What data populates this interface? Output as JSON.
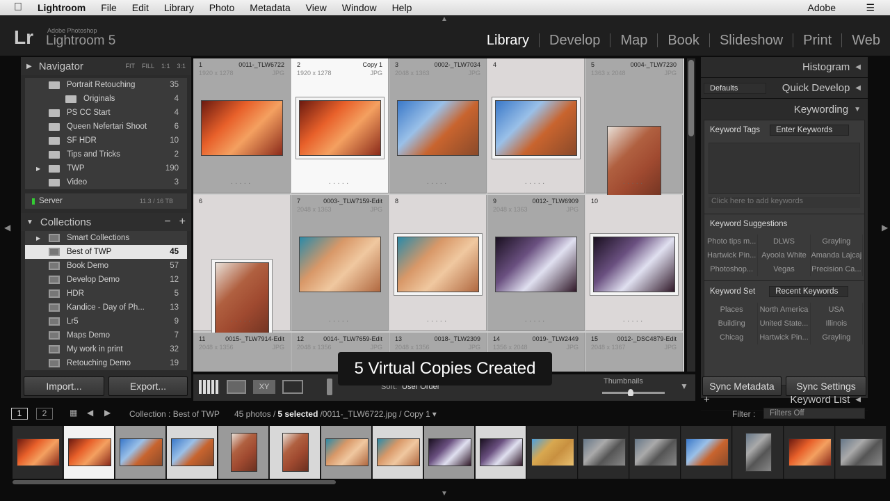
{
  "menubar": {
    "app": "Lightroom",
    "items": [
      "File",
      "Edit",
      "Library",
      "Photo",
      "Metadata",
      "View",
      "Window",
      "Help"
    ],
    "right": "Adobe"
  },
  "brand": {
    "logo": "Lr",
    "sub": "Adobe Photoshop",
    "name": "Lightroom 5"
  },
  "modules": [
    {
      "label": "Library",
      "active": true
    },
    {
      "label": "Develop"
    },
    {
      "label": "Map"
    },
    {
      "label": "Book"
    },
    {
      "label": "Slideshow"
    },
    {
      "label": "Print"
    },
    {
      "label": "Web"
    }
  ],
  "navigator": {
    "title": "Navigator",
    "zoom": [
      "FIT",
      "FILL",
      "1:1",
      "3:1"
    ]
  },
  "folders": [
    {
      "label": "Portrait Retouching",
      "count": "35",
      "indent": 1
    },
    {
      "label": "Originals",
      "count": "4",
      "indent": 2
    },
    {
      "label": "PS CC Start",
      "count": "4",
      "indent": 1
    },
    {
      "label": "Queen Nefertari Shoot",
      "count": "6",
      "indent": 1
    },
    {
      "label": "SF HDR",
      "count": "10",
      "indent": 1
    },
    {
      "label": "Tips and Tricks",
      "count": "2",
      "indent": 1
    },
    {
      "label": "TWP",
      "count": "190",
      "indent": 1,
      "expandable": true
    },
    {
      "label": "Video",
      "count": "3",
      "indent": 1
    }
  ],
  "volume": {
    "label": "Server",
    "usage": "11.3 / 16 TB"
  },
  "collections": {
    "title": "Collections",
    "items": [
      {
        "label": "Smart Collections",
        "count": "",
        "expandable": true
      },
      {
        "label": "Best of TWP",
        "count": "45",
        "selected": true
      },
      {
        "label": "Book Demo",
        "count": "57"
      },
      {
        "label": "Develop Demo",
        "count": "12"
      },
      {
        "label": "HDR",
        "count": "5"
      },
      {
        "label": "Kandice - Day of Ph...",
        "count": "13"
      },
      {
        "label": "Lr5",
        "count": "9"
      },
      {
        "label": "Maps Demo",
        "count": "7"
      },
      {
        "label": "My work in print",
        "count": "32"
      },
      {
        "label": "Retouching Demo",
        "count": "19"
      }
    ]
  },
  "buttons": {
    "import": "Import...",
    "export": "Export...",
    "sync_metadata": "Sync Metadata",
    "sync_settings": "Sync Settings"
  },
  "grid": [
    {
      "num": "1",
      "name": "0011-_TLW6722",
      "dims": "1920 x 1278",
      "ext": "JPG",
      "state": "selected",
      "thumb": "canyon",
      "orient": "land"
    },
    {
      "num": "2",
      "name": "Copy 1",
      "dims": "1920 x 1278",
      "ext": "JPG",
      "state": "primary",
      "thumb": "canyon",
      "orient": "land"
    },
    {
      "num": "3",
      "name": "0002-_TLW7034",
      "dims": "2048 x 1363",
      "ext": "JPG",
      "state": "selected",
      "thumb": "monument",
      "orient": "land"
    },
    {
      "num": "4",
      "name": "",
      "dims": "",
      "ext": "",
      "state": "light",
      "thumb": "monument",
      "orient": "land"
    },
    {
      "num": "5",
      "name": "0004-_TLW7230",
      "dims": "1363 x 2048",
      "ext": "JPG",
      "state": "selected",
      "thumb": "tree",
      "orient": "port"
    },
    {
      "num": "6",
      "name": "",
      "dims": "",
      "ext": "",
      "state": "light",
      "thumb": "tree",
      "orient": "port"
    },
    {
      "num": "7",
      "name": "0003-_TLW7159-Edit",
      "dims": "2048 x 1363",
      "ext": "JPG",
      "state": "selected",
      "thumb": "arch",
      "orient": "land"
    },
    {
      "num": "8",
      "name": "",
      "dims": "",
      "ext": "",
      "state": "light",
      "thumb": "arch",
      "orient": "land"
    },
    {
      "num": "9",
      "name": "0012-_TLW6909",
      "dims": "2048 x 1363",
      "ext": "JPG",
      "state": "selected",
      "thumb": "slot",
      "orient": "land"
    },
    {
      "num": "10",
      "name": "",
      "dims": "",
      "ext": "",
      "state": "light",
      "thumb": "slot",
      "orient": "land"
    },
    {
      "num": "11",
      "name": "0015-_TLW7914-Edit",
      "dims": "2048 x 1356",
      "ext": "JPG",
      "state": "selected"
    },
    {
      "num": "12",
      "name": "0014-_TLW7659-Edit",
      "dims": "2048 x 1356",
      "ext": "JPG",
      "state": "selected"
    },
    {
      "num": "13",
      "name": "0018-_TLW2309",
      "dims": "2048 x 1356",
      "ext": "JPG",
      "state": "selected"
    },
    {
      "num": "14",
      "name": "0019-_TLW2449",
      "dims": "1356 x 2048",
      "ext": "JPG",
      "state": "selected"
    },
    {
      "num": "15",
      "name": "0012-_DSC4879-Edit",
      "dims": "2048 x 1367",
      "ext": "JPG",
      "state": "selected"
    }
  ],
  "thumb_colors": {
    "canyon": [
      "#6b1a10",
      "#e8602a",
      "#f4a060",
      "#8a2a1a"
    ],
    "monument": [
      "#3a78c8",
      "#9ac0e8",
      "#c8642e",
      "#8a4a2a"
    ],
    "tree": [
      "#e8e0d8",
      "#b06040",
      "#a04a30",
      "#6a3020"
    ],
    "arch": [
      "#2a8aa8",
      "#d89868",
      "#f0c8a0",
      "#b06840"
    ],
    "slot": [
      "#1a1020",
      "#6a5080",
      "#e0e0f0",
      "#301828"
    ],
    "sphinx": [
      "#4aa0e0",
      "#d8a850",
      "#c89040",
      "#e8c070"
    ],
    "other": [
      "#667788",
      "#aaaaaa",
      "#555555",
      "#888888"
    ]
  },
  "toast": "5 Virtual Copies Created",
  "toolbar": {
    "sort_label": "Sort:",
    "sort_value": "User Order",
    "thumbnails_label": "Thumbnails",
    "thumbnail_size": 0.45
  },
  "right": {
    "histogram": "Histogram",
    "preset": "Defaults",
    "quick_develop": "Quick Develop",
    "keywording": "Keywording",
    "keyword_tags": "Keyword Tags",
    "enter_keywords": "Enter Keywords",
    "add_placeholder": "Click here to add keywords",
    "suggestions_title": "Keyword Suggestions",
    "suggestions": [
      "Photo tips m...",
      "DLWS",
      "Grayling",
      "Hartwick Pin...",
      "Ayoola White",
      "Amanda Lajcaj",
      "Photoshop...",
      "Vegas",
      "Precision Ca..."
    ],
    "set_title": "Keyword Set",
    "set_value": "Recent Keywords",
    "set": [
      "Places",
      "North America",
      "USA",
      "Building",
      "United State...",
      "Illinois",
      "Chicag",
      "Hartwick Pin...",
      "Grayling"
    ],
    "keyword_list": "Keyword List"
  },
  "filmstrip": {
    "pages": [
      "1",
      "2"
    ],
    "source": "Collection : Best of TWP",
    "count": "45 photos /",
    "selected": "5 selected",
    "file": "/0011-_TLW6722.jpg / Copy 1",
    "filter_label": "Filter :",
    "filter_value": "Filters Off",
    "thumbs": [
      {
        "t": "canyon",
        "s": ""
      },
      {
        "t": "canyon",
        "s": "primary"
      },
      {
        "t": "monument",
        "s": "sel"
      },
      {
        "t": "monument",
        "s": "light"
      },
      {
        "t": "tree",
        "s": "sel"
      },
      {
        "t": "tree",
        "s": "light"
      },
      {
        "t": "arch",
        "s": "sel"
      },
      {
        "t": "arch",
        "s": "light"
      },
      {
        "t": "slot",
        "s": "sel"
      },
      {
        "t": "slot",
        "s": "light"
      },
      {
        "t": "sphinx",
        "s": ""
      },
      {
        "t": "other",
        "s": ""
      },
      {
        "t": "other",
        "s": ""
      },
      {
        "t": "monument",
        "s": ""
      },
      {
        "t": "other",
        "s": ""
      },
      {
        "t": "canyon",
        "s": ""
      },
      {
        "t": "other",
        "s": ""
      }
    ]
  }
}
